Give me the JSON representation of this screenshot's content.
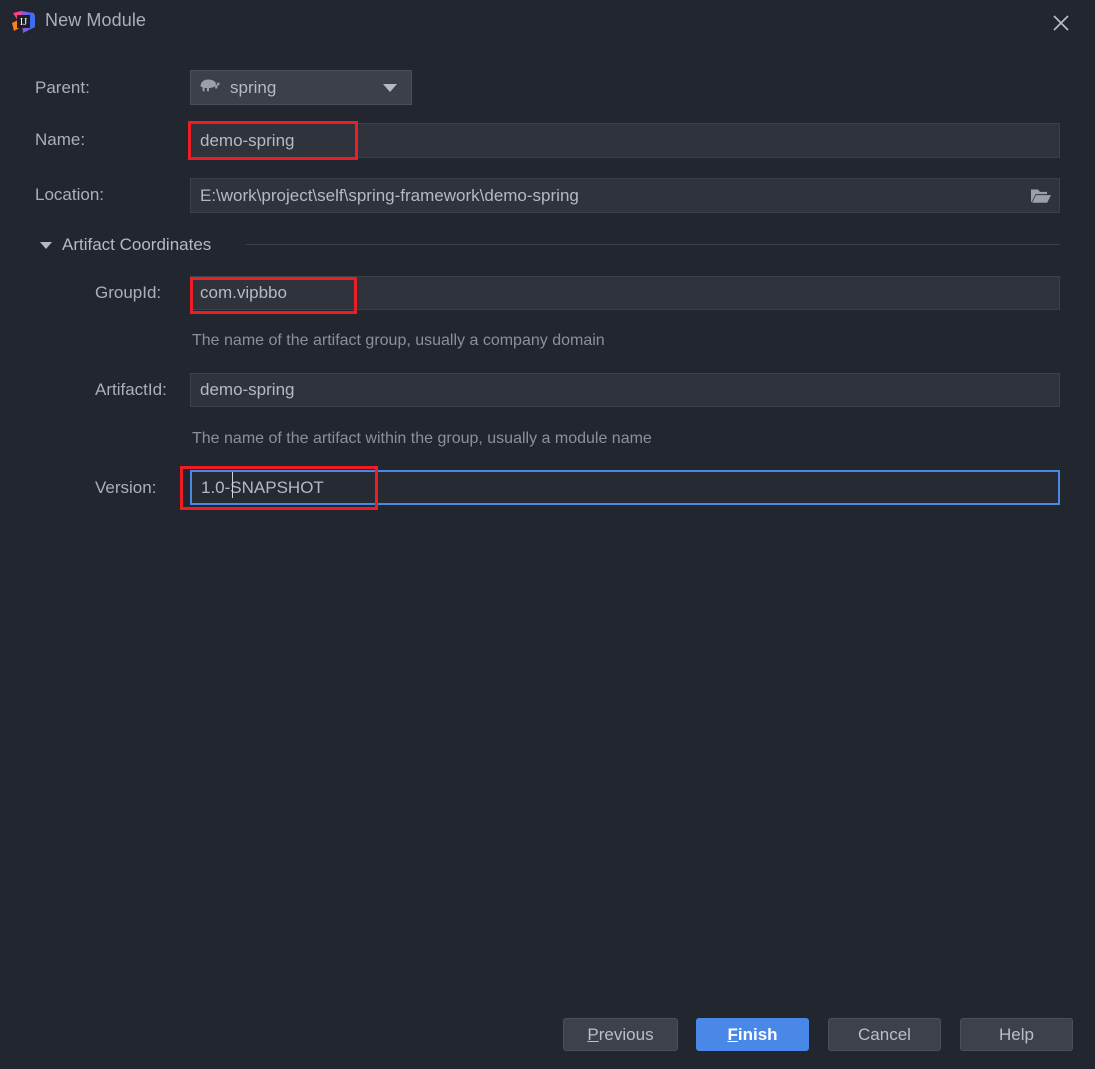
{
  "window": {
    "title": "New Module",
    "logo_icon": "intellij-idea-logo",
    "close_icon": "close-icon"
  },
  "form": {
    "parent": {
      "label": "Parent:",
      "value": "spring",
      "icon": "gradle-elephant-icon",
      "caret_icon": "chevron-down-icon"
    },
    "name": {
      "label": "Name:",
      "value": "demo-spring"
    },
    "location": {
      "label": "Location:",
      "value": "E:\\work\\project\\self\\spring-framework\\demo-spring",
      "browse_icon": "folder-open-icon"
    },
    "section": {
      "title": "Artifact Coordinates",
      "caret_icon": "triangle-down-icon",
      "expanded": true
    },
    "group_id": {
      "label": "GroupId:",
      "value": "com.vipbbo",
      "hint": "The name of the artifact group, usually a company domain"
    },
    "artifact_id": {
      "label": "ArtifactId:",
      "value": "demo-spring",
      "hint": "The name of the artifact within the group, usually a module name"
    },
    "version": {
      "label": "Version:",
      "value": "1.0-SNAPSHOT",
      "focused": true
    }
  },
  "footer": {
    "previous": {
      "prefix": "P",
      "rest": "revious"
    },
    "finish": {
      "prefix": "F",
      "rest": "inish"
    },
    "cancel": "Cancel",
    "help": "Help"
  },
  "colors": {
    "background": "#22262e",
    "field_bg": "#2f333b",
    "accent_blue": "#4a88e8",
    "annotation_red": "#ee1c24",
    "text": "#b3bac4",
    "hint_text": "#8b9199"
  }
}
